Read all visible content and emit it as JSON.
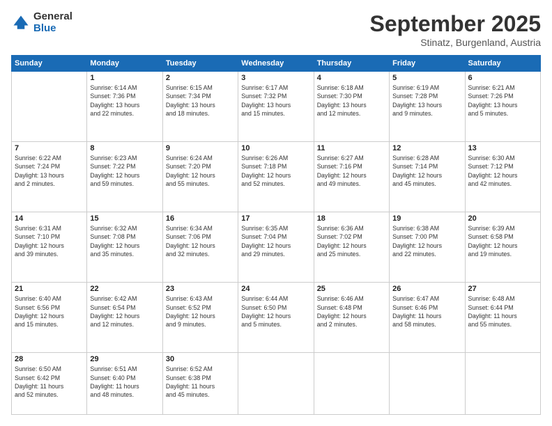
{
  "logo": {
    "general": "General",
    "blue": "Blue"
  },
  "header": {
    "month": "September 2025",
    "location": "Stinatz, Burgenland, Austria"
  },
  "weekdays": [
    "Sunday",
    "Monday",
    "Tuesday",
    "Wednesday",
    "Thursday",
    "Friday",
    "Saturday"
  ],
  "weeks": [
    [
      {
        "day": "",
        "info": ""
      },
      {
        "day": "1",
        "info": "Sunrise: 6:14 AM\nSunset: 7:36 PM\nDaylight: 13 hours\nand 22 minutes."
      },
      {
        "day": "2",
        "info": "Sunrise: 6:15 AM\nSunset: 7:34 PM\nDaylight: 13 hours\nand 18 minutes."
      },
      {
        "day": "3",
        "info": "Sunrise: 6:17 AM\nSunset: 7:32 PM\nDaylight: 13 hours\nand 15 minutes."
      },
      {
        "day": "4",
        "info": "Sunrise: 6:18 AM\nSunset: 7:30 PM\nDaylight: 13 hours\nand 12 minutes."
      },
      {
        "day": "5",
        "info": "Sunrise: 6:19 AM\nSunset: 7:28 PM\nDaylight: 13 hours\nand 9 minutes."
      },
      {
        "day": "6",
        "info": "Sunrise: 6:21 AM\nSunset: 7:26 PM\nDaylight: 13 hours\nand 5 minutes."
      }
    ],
    [
      {
        "day": "7",
        "info": "Sunrise: 6:22 AM\nSunset: 7:24 PM\nDaylight: 13 hours\nand 2 minutes."
      },
      {
        "day": "8",
        "info": "Sunrise: 6:23 AM\nSunset: 7:22 PM\nDaylight: 12 hours\nand 59 minutes."
      },
      {
        "day": "9",
        "info": "Sunrise: 6:24 AM\nSunset: 7:20 PM\nDaylight: 12 hours\nand 55 minutes."
      },
      {
        "day": "10",
        "info": "Sunrise: 6:26 AM\nSunset: 7:18 PM\nDaylight: 12 hours\nand 52 minutes."
      },
      {
        "day": "11",
        "info": "Sunrise: 6:27 AM\nSunset: 7:16 PM\nDaylight: 12 hours\nand 49 minutes."
      },
      {
        "day": "12",
        "info": "Sunrise: 6:28 AM\nSunset: 7:14 PM\nDaylight: 12 hours\nand 45 minutes."
      },
      {
        "day": "13",
        "info": "Sunrise: 6:30 AM\nSunset: 7:12 PM\nDaylight: 12 hours\nand 42 minutes."
      }
    ],
    [
      {
        "day": "14",
        "info": "Sunrise: 6:31 AM\nSunset: 7:10 PM\nDaylight: 12 hours\nand 39 minutes."
      },
      {
        "day": "15",
        "info": "Sunrise: 6:32 AM\nSunset: 7:08 PM\nDaylight: 12 hours\nand 35 minutes."
      },
      {
        "day": "16",
        "info": "Sunrise: 6:34 AM\nSunset: 7:06 PM\nDaylight: 12 hours\nand 32 minutes."
      },
      {
        "day": "17",
        "info": "Sunrise: 6:35 AM\nSunset: 7:04 PM\nDaylight: 12 hours\nand 29 minutes."
      },
      {
        "day": "18",
        "info": "Sunrise: 6:36 AM\nSunset: 7:02 PM\nDaylight: 12 hours\nand 25 minutes."
      },
      {
        "day": "19",
        "info": "Sunrise: 6:38 AM\nSunset: 7:00 PM\nDaylight: 12 hours\nand 22 minutes."
      },
      {
        "day": "20",
        "info": "Sunrise: 6:39 AM\nSunset: 6:58 PM\nDaylight: 12 hours\nand 19 minutes."
      }
    ],
    [
      {
        "day": "21",
        "info": "Sunrise: 6:40 AM\nSunset: 6:56 PM\nDaylight: 12 hours\nand 15 minutes."
      },
      {
        "day": "22",
        "info": "Sunrise: 6:42 AM\nSunset: 6:54 PM\nDaylight: 12 hours\nand 12 minutes."
      },
      {
        "day": "23",
        "info": "Sunrise: 6:43 AM\nSunset: 6:52 PM\nDaylight: 12 hours\nand 9 minutes."
      },
      {
        "day": "24",
        "info": "Sunrise: 6:44 AM\nSunset: 6:50 PM\nDaylight: 12 hours\nand 5 minutes."
      },
      {
        "day": "25",
        "info": "Sunrise: 6:46 AM\nSunset: 6:48 PM\nDaylight: 12 hours\nand 2 minutes."
      },
      {
        "day": "26",
        "info": "Sunrise: 6:47 AM\nSunset: 6:46 PM\nDaylight: 11 hours\nand 58 minutes."
      },
      {
        "day": "27",
        "info": "Sunrise: 6:48 AM\nSunset: 6:44 PM\nDaylight: 11 hours\nand 55 minutes."
      }
    ],
    [
      {
        "day": "28",
        "info": "Sunrise: 6:50 AM\nSunset: 6:42 PM\nDaylight: 11 hours\nand 52 minutes."
      },
      {
        "day": "29",
        "info": "Sunrise: 6:51 AM\nSunset: 6:40 PM\nDaylight: 11 hours\nand 48 minutes."
      },
      {
        "day": "30",
        "info": "Sunrise: 6:52 AM\nSunset: 6:38 PM\nDaylight: 11 hours\nand 45 minutes."
      },
      {
        "day": "",
        "info": ""
      },
      {
        "day": "",
        "info": ""
      },
      {
        "day": "",
        "info": ""
      },
      {
        "day": "",
        "info": ""
      }
    ]
  ]
}
